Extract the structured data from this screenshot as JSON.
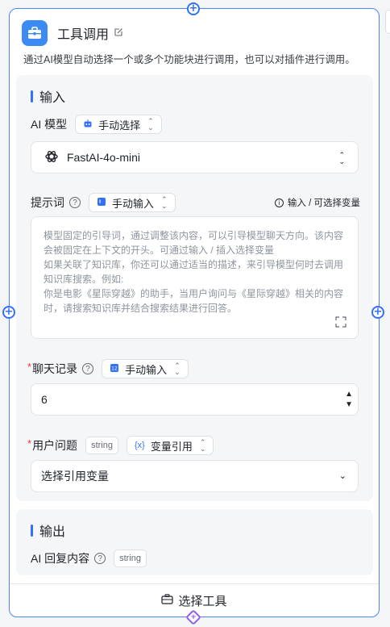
{
  "node": {
    "title": "工具调用",
    "description": "通过AI模型自动选择一个或多个功能块进行调用，也可以对插件进行调用。"
  },
  "input_section": {
    "title": "输入",
    "ai_model": {
      "label": "AI 模型",
      "mode": "手动选择",
      "selected_model": "FastAI-4o-mini"
    },
    "prompt": {
      "label": "提示词",
      "mode": "手动输入",
      "hint": "输入 / 可选择变量",
      "placeholder": "模型固定的引导词，通过调整该内容，可以引导模型聊天方向。该内容会被固定在上下文的开头。可通过输入 / 插入选择变量\n如果关联了知识库，你还可以通过适当的描述，来引导模型何时去调用知识库搜索。例如:\n你是电影《星际穿越》的助手，当用户询问与《星际穿越》相关的内容时，请搜索知识库并结合搜索结果进行回答。"
    },
    "chat_history": {
      "required_mark": "*",
      "label": "聊天记录",
      "mode": "手动输入",
      "value": "6"
    },
    "user_question": {
      "required_mark": "*",
      "label": "用户问题",
      "type_tag": "string",
      "mode": "变量引用",
      "placeholder": "选择引用变量"
    }
  },
  "output_section": {
    "title": "输出",
    "ai_reply": {
      "label": "AI 回复内容",
      "type_tag": "string"
    }
  },
  "footer": {
    "select_tool_label": "选择工具"
  },
  "colors": {
    "accent": "#3370ff",
    "icon_bg": "#3c8bf5",
    "required": "#e53935"
  }
}
